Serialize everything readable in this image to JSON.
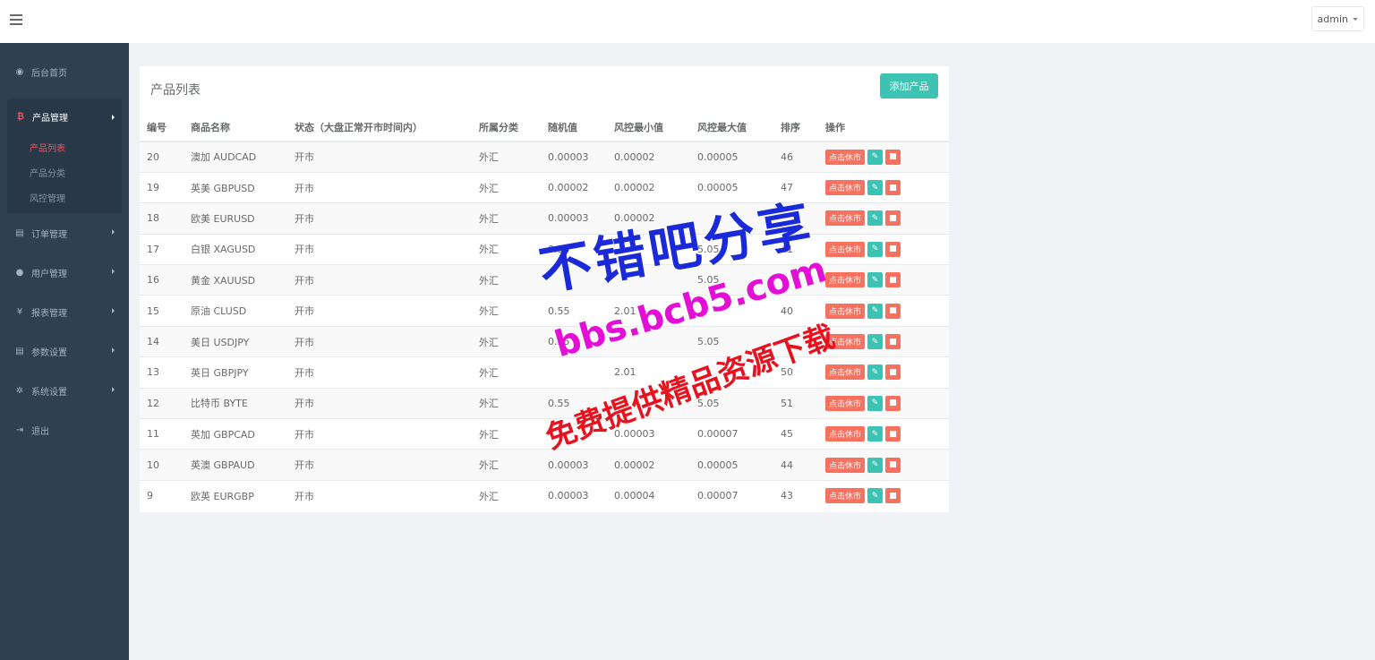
{
  "header": {
    "user_name": "admin"
  },
  "sidebar": {
    "items": [
      {
        "label": "后台首页",
        "icon": "dashboard-icon"
      },
      {
        "label": "产品管理",
        "icon": "bitcoin-icon",
        "active": true,
        "children": [
          {
            "label": "产品列表",
            "active": true
          },
          {
            "label": "产品分类"
          },
          {
            "label": "风控管理"
          }
        ]
      },
      {
        "label": "订单管理",
        "icon": "copy-icon"
      },
      {
        "label": "用户管理",
        "icon": "user-icon"
      },
      {
        "label": "报表管理",
        "icon": "yen-icon"
      },
      {
        "label": "参数设置",
        "icon": "copy-icon"
      },
      {
        "label": "系统设置",
        "icon": "gears-icon"
      },
      {
        "label": "退出",
        "icon": "sign-out-icon"
      }
    ],
    "icon_glyphs": {
      "dashboard": "◉",
      "bitcoin": "₿",
      "copy": "▤",
      "user": "●",
      "yen": "¥",
      "gears": "✲",
      "signout": "⇥"
    }
  },
  "main": {
    "title": "产品列表",
    "add_button": "添加产品",
    "columns": [
      "编号",
      "商品名称",
      "状态（大盘正常开市时间内）",
      "所属分类",
      "随机值",
      "风控最小值",
      "风控最大值",
      "排序",
      "操作"
    ],
    "close_label": "点击休市",
    "rows": [
      {
        "id": "20",
        "name": "澳加 AUDCAD",
        "status": "开市",
        "category": "外汇",
        "random": "0.00003",
        "min": "0.00002",
        "max": "0.00005",
        "sort": "46"
      },
      {
        "id": "19",
        "name": "英美 GBPUSD",
        "status": "开市",
        "category": "外汇",
        "random": "0.00002",
        "min": "0.00002",
        "max": "0.00005",
        "sort": "47"
      },
      {
        "id": "18",
        "name": "欧美 EURUSD",
        "status": "开市",
        "category": "外汇",
        "random": "0.00003",
        "min": "0.00002",
        "max": "",
        "sort": ""
      },
      {
        "id": "17",
        "name": "白银 XAGUSD",
        "status": "开市",
        "category": "外汇",
        "random": "0.55",
        "min": "",
        "max": "5.05",
        "sort": "41"
      },
      {
        "id": "16",
        "name": "黄金 XAUUSD",
        "status": "开市",
        "category": "外汇",
        "random": "",
        "min": "",
        "max": "5.05",
        "sort": ""
      },
      {
        "id": "15",
        "name": "原油 CLUSD",
        "status": "开市",
        "category": "外汇",
        "random": "0.55",
        "min": "2.01",
        "max": "",
        "sort": "40"
      },
      {
        "id": "14",
        "name": "美日 USDJPY",
        "status": "开市",
        "category": "外汇",
        "random": "0.55",
        "min": "",
        "max": "5.05",
        "sort": ""
      },
      {
        "id": "13",
        "name": "英日 GBPJPY",
        "status": "开市",
        "category": "外汇",
        "random": "",
        "min": "2.01",
        "max": "",
        "sort": "50"
      },
      {
        "id": "12",
        "name": "比特币 BYTE",
        "status": "开市",
        "category": "外汇",
        "random": "0.55",
        "min": "",
        "max": "5.05",
        "sort": "51"
      },
      {
        "id": "11",
        "name": "英加 GBPCAD",
        "status": "开市",
        "category": "外汇",
        "random": "",
        "min": "0.00003",
        "max": "0.00007",
        "sort": "45"
      },
      {
        "id": "10",
        "name": "英澳 GBPAUD",
        "status": "开市",
        "category": "外汇",
        "random": "0.00003",
        "min": "0.00002",
        "max": "0.00005",
        "sort": "44"
      },
      {
        "id": "9",
        "name": "欧英 EURGBP",
        "status": "开市",
        "category": "外汇",
        "random": "0.00003",
        "min": "0.00004",
        "max": "0.00007",
        "sort": "43"
      }
    ]
  },
  "watermark": {
    "line1": "不错吧分享",
    "line2": "bbs.bcb5.com",
    "line3": "免费提供精品资源下载"
  }
}
